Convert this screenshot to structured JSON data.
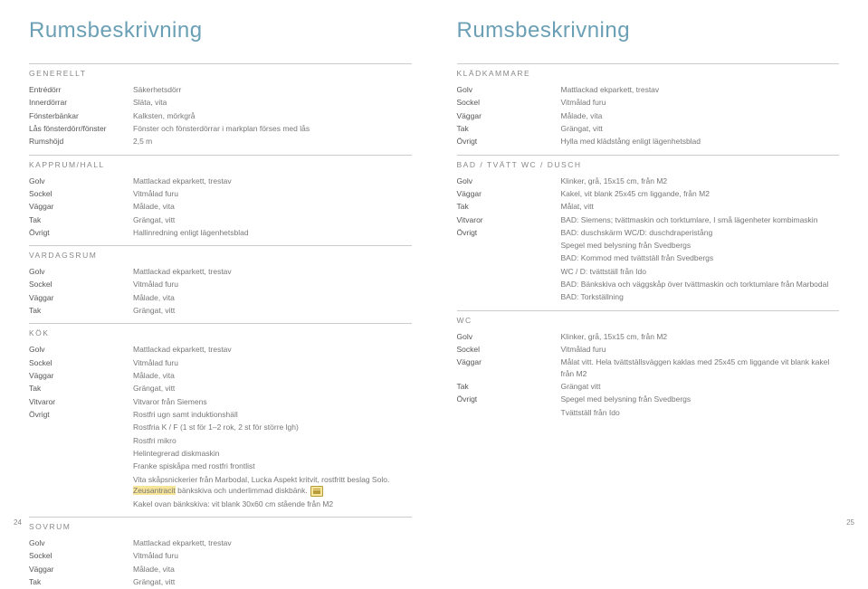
{
  "title": "Rumsbeskrivning",
  "left": {
    "sections": [
      {
        "name": "GENERELLT",
        "rows": [
          {
            "l": "Entrédörr",
            "v": "Säkerhetsdörr"
          },
          {
            "l": "Innerdörrar",
            "v": "Släta, vita"
          },
          {
            "l": "Fönsterbänkar",
            "v": "Kalksten, mörkgrå"
          },
          {
            "l": "Lås fönsterdörr/fönster",
            "v": "Fönster och fönsterdörrar i markplan förses med lås"
          },
          {
            "l": "Rumshöjd",
            "v": "2,5 m"
          }
        ]
      },
      {
        "name": "KAPPRUM/HALL",
        "rows": [
          {
            "l": "Golv",
            "v": "Mattlackad ekparkett, trestav"
          },
          {
            "l": "Sockel",
            "v": "Vitmålad furu"
          },
          {
            "l": "Väggar",
            "v": "Målade, vita"
          },
          {
            "l": "Tak",
            "v": "Grängat, vitt"
          },
          {
            "l": "Övrigt",
            "v": "Hallinredning enligt lägenhetsblad"
          }
        ]
      },
      {
        "name": "VARDAGSRUM",
        "rows": [
          {
            "l": "Golv",
            "v": "Mattlackad ekparkett, trestav"
          },
          {
            "l": "Sockel",
            "v": "Vitmålad furu"
          },
          {
            "l": "Väggar",
            "v": "Målade, vita"
          },
          {
            "l": "Tak",
            "v": "Grängat, vitt"
          }
        ]
      },
      {
        "name": "KÖK",
        "rows": [
          {
            "l": "Golv",
            "v": "Mattlackad ekparkett, trestav"
          },
          {
            "l": "Sockel",
            "v": "Vitmålad furu"
          },
          {
            "l": "Väggar",
            "v": "Målade, vita"
          },
          {
            "l": "Tak",
            "v": "Grängat, vitt"
          },
          {
            "l": "Vitvaror",
            "v": "Vitvaror från Siemens"
          },
          {
            "l": "Övrigt",
            "v": "Rostfri ugn samt induktionshäll"
          },
          {
            "l": "",
            "v": "Rostfria K / F (1 st för 1–2 rok, 2 st för större lgh)"
          },
          {
            "l": "",
            "v": "Rostfri mikro"
          },
          {
            "l": "",
            "v": "Helintegrerad diskmaskin"
          },
          {
            "l": "",
            "v": "Franke spiskåpa med rostfri frontlist"
          },
          {
            "l": "",
            "v": "Vita skåpsnickerier från Marbodal, Lucka Aspekt kritvit, rostfritt beslag Solo. <hl>Zeusantracit</hl> bänkskiva och underlimmad diskbänk.",
            "note": true
          },
          {
            "l": "",
            "v": "Kakel ovan bänkskiva: vit blank 30x60 cm stående från M2"
          }
        ]
      },
      {
        "name": "SOVRUM",
        "rows": [
          {
            "l": "Golv",
            "v": "Mattlackad ekparkett, trestav"
          },
          {
            "l": "Sockel",
            "v": "Vitmålad furu"
          },
          {
            "l": "Väggar",
            "v": "Målade, vita"
          },
          {
            "l": "Tak",
            "v": "Grängat, vitt"
          }
        ]
      }
    ]
  },
  "right": {
    "sections": [
      {
        "name": "KLÄDKAMMARE",
        "rows": [
          {
            "l": "Golv",
            "v": "Mattlackad ekparkett, trestav"
          },
          {
            "l": "Sockel",
            "v": "Vitmålad furu"
          },
          {
            "l": "Väggar",
            "v": "Målade, vita"
          },
          {
            "l": "Tak",
            "v": "Grängat, vitt"
          },
          {
            "l": "Övrigt",
            "v": "Hylla med klädstång enligt lägenhetsblad"
          }
        ]
      },
      {
        "name": "BAD / TVÄTT  WC / DUSCH",
        "rows": [
          {
            "l": "Golv",
            "v": "Klinker, grå, 15x15 cm, från M2"
          },
          {
            "l": "Väggar",
            "v": "Kakel, vit blank 25x45 cm liggande, från M2"
          },
          {
            "l": "Tak",
            "v": "Målat, vitt"
          },
          {
            "l": "Vitvaror",
            "v": "BAD: Siemens; tvättmaskin och torktumlare, I små lägenheter kombimaskin"
          },
          {
            "l": "Övrigt",
            "v": "BAD: duschskärm WC/D: duschdraperistång"
          },
          {
            "l": "",
            "v": "Spegel med belysning från Svedbergs"
          },
          {
            "l": "",
            "v": "BAD: Kommod med tvättställ från Svedbergs"
          },
          {
            "l": "",
            "v": "WC / D: tvättställ från Ido"
          },
          {
            "l": "",
            "v": "BAD: Bänkskiva och väggskåp över tvättmaskin och torktumlare från Marbodal"
          },
          {
            "l": "",
            "v": "BAD: Torkställning"
          }
        ]
      },
      {
        "name": "WC",
        "rows": [
          {
            "l": "Golv",
            "v": "Klinker, grå, 15x15 cm, från M2"
          },
          {
            "l": "Sockel",
            "v": "Vitmålad furu"
          },
          {
            "l": "Väggar",
            "v": "Målat vitt. Hela tvättställsväggen kaklas med 25x45 cm liggande vit blank kakel från M2"
          },
          {
            "l": "Tak",
            "v": "Grängat vitt"
          },
          {
            "l": "Övrigt",
            "v": "Spegel med belysning från Svedbergs"
          },
          {
            "l": "",
            "v": "Tvättställ från Ido"
          }
        ]
      }
    ]
  },
  "pageLeft": "24",
  "pageRight": "25"
}
